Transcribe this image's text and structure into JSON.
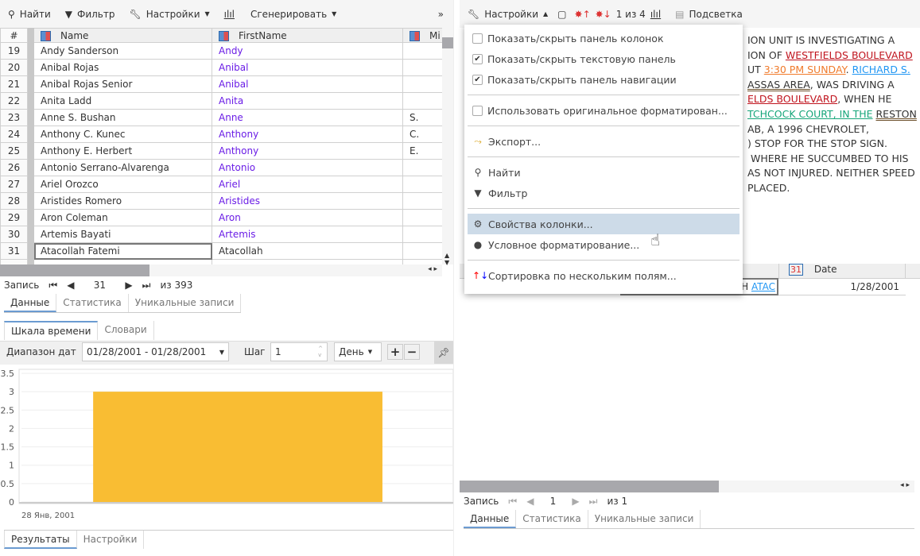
{
  "left": {
    "toolbar": {
      "find": "Найти",
      "filter": "Фильтр",
      "settings": "Настройки",
      "generate": "Сгенерировать",
      "more": "»"
    },
    "grid": {
      "headers": [
        "#",
        "Name",
        "FirstName",
        "Mi"
      ],
      "rows": [
        {
          "n": "19",
          "name": "Andy Sanderson",
          "first": "Andy",
          "mi": ""
        },
        {
          "n": "20",
          "name": "Anibal Rojas",
          "first": "Anibal",
          "mi": ""
        },
        {
          "n": "21",
          "name": "Anibal Rojas Senior",
          "first": "Anibal",
          "mi": ""
        },
        {
          "n": "22",
          "name": "Anita Ladd",
          "first": "Anita",
          "mi": ""
        },
        {
          "n": "23",
          "name": "Anne S. Bushan",
          "first": "Anne",
          "mi": "S."
        },
        {
          "n": "24",
          "name": "Anthony C. Kunec",
          "first": "Anthony",
          "mi": "C."
        },
        {
          "n": "25",
          "name": "Anthony E. Herbert",
          "first": "Anthony",
          "mi": "E."
        },
        {
          "n": "26",
          "name": "Antonio Serrano-Alvarenga",
          "first": "Antonio",
          "mi": ""
        },
        {
          "n": "27",
          "name": "Ariel Orozco",
          "first": "Ariel",
          "mi": ""
        },
        {
          "n": "28",
          "name": "Aristides Romero",
          "first": "Aristides",
          "mi": ""
        },
        {
          "n": "29",
          "name": "Aron Coleman",
          "first": "Aron",
          "mi": ""
        },
        {
          "n": "30",
          "name": "Artemis Bayati",
          "first": "Artemis",
          "mi": ""
        },
        {
          "n": "31",
          "name": "Atacollah Fatemi",
          "first": "Atacollah",
          "mi": ""
        }
      ]
    },
    "nav": {
      "label": "Запись",
      "current": "31",
      "total": "из 393"
    },
    "tabs": [
      "Данные",
      "Статистика",
      "Уникальные записи"
    ],
    "tabs2": [
      "Шкала времени",
      "Словари"
    ],
    "timeline": {
      "range_label": "Диапазон дат",
      "range": "01/28/2001 - 01/28/2001",
      "step_label": "Шаг",
      "step": "1",
      "unit": "День"
    },
    "bottom_tabs": [
      "Результаты",
      "Настройки"
    ]
  },
  "chart_data": {
    "type": "bar",
    "categories": [
      "28 Янв, 2001"
    ],
    "values": [
      3
    ],
    "ylim": [
      0,
      3.5
    ],
    "yticks": [
      "0",
      "0.5",
      "1",
      "1.5",
      "2",
      "2.5",
      "3",
      "3.5"
    ],
    "grid": true,
    "color": "#f9bd33"
  },
  "right": {
    "toolbar": {
      "settings": "Настройки",
      "counter": "1 из 4",
      "highlight": "Подсветка"
    },
    "text_lines": [
      [
        {
          "t": "ION UNIT IS INVESTIGATING A"
        }
      ],
      [
        {
          "t": "ION OF "
        },
        {
          "t": "WESTFIELDS BOULEVARD",
          "c": "u1"
        }
      ],
      [
        {
          "t": "UT "
        },
        {
          "t": "3:30 PM SUNDAY",
          "c": "u2"
        },
        {
          "t": ". "
        },
        {
          "t": "RICHARD S.",
          "c": "u3"
        }
      ],
      [
        {
          "t": "ASSAS AREA",
          "c": "u4"
        },
        {
          "t": ", WAS DRIVING A"
        }
      ],
      [
        {
          "t": "ELDS BOULEVARD",
          "c": "u1"
        },
        {
          "t": ", WHEN HE"
        }
      ],
      [
        {
          "t": "TCHCOCK COURT, IN THE",
          "c": "u5"
        },
        {
          "t": " "
        },
        {
          "t": "RESTON",
          "c": "u4"
        }
      ],
      [
        {
          "t": "AB, A 1996 CHEVROLET,"
        }
      ],
      [
        {
          "t": ") STOP FOR THE STOP SIGN."
        }
      ],
      [
        {
          "t": " WHERE HE SUCCUMBED TO HIS"
        }
      ],
      [
        {
          "t": "AS NOT INJURED. NEITHER SPEED"
        }
      ],
      [
        {
          "t": "PLACED."
        }
      ]
    ],
    "grid": {
      "date_header": "Date",
      "cell_text": "TH ",
      "cell_link": "ATAC",
      "date": "1/28/2001"
    },
    "nav": {
      "label": "Запись",
      "current": "1",
      "total": "из 1"
    },
    "tabs": [
      "Данные",
      "Статистика",
      "Уникальные записи"
    ]
  },
  "menu": {
    "items": [
      {
        "label": "Показать/скрыть панель колонок",
        "checked": false
      },
      {
        "label": "Показать/скрыть текстовую панель",
        "checked": true
      },
      {
        "label": "Показать/скрыть панель навигации",
        "checked": true
      },
      {
        "label": "Использовать оригинальное форматирован...",
        "checked": false
      },
      {
        "label": "Экспорт..."
      },
      {
        "label": "Найти"
      },
      {
        "label": "Фильтр"
      },
      {
        "label": "Свойства колонки..."
      },
      {
        "label": "Условное форматирование..."
      },
      {
        "label": "Сортировка по нескольким полям..."
      }
    ]
  }
}
